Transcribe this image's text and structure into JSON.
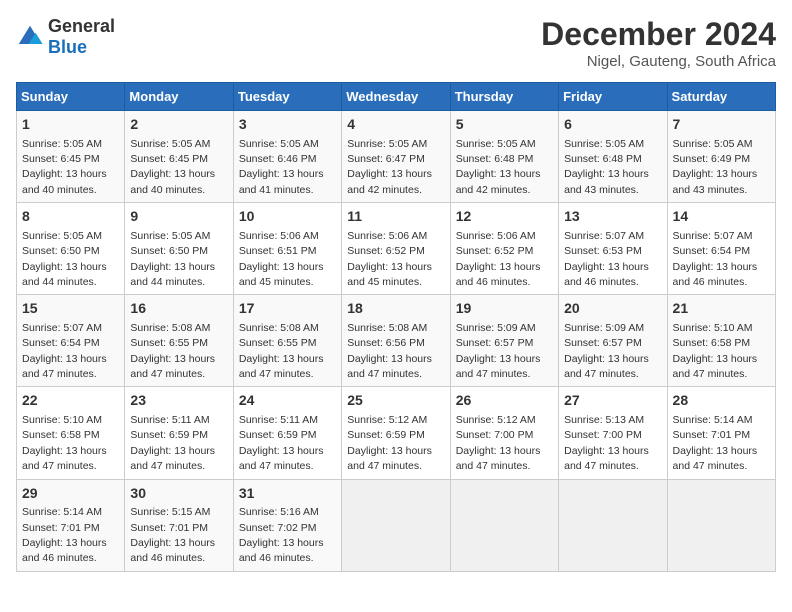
{
  "logo": {
    "general": "General",
    "blue": "Blue"
  },
  "title": "December 2024",
  "subtitle": "Nigel, Gauteng, South Africa",
  "days_of_week": [
    "Sunday",
    "Monday",
    "Tuesday",
    "Wednesday",
    "Thursday",
    "Friday",
    "Saturday"
  ],
  "weeks": [
    [
      {
        "day": "1",
        "info": "Sunrise: 5:05 AM\nSunset: 6:45 PM\nDaylight: 13 hours\nand 40 minutes."
      },
      {
        "day": "2",
        "info": "Sunrise: 5:05 AM\nSunset: 6:45 PM\nDaylight: 13 hours\nand 40 minutes."
      },
      {
        "day": "3",
        "info": "Sunrise: 5:05 AM\nSunset: 6:46 PM\nDaylight: 13 hours\nand 41 minutes."
      },
      {
        "day": "4",
        "info": "Sunrise: 5:05 AM\nSunset: 6:47 PM\nDaylight: 13 hours\nand 42 minutes."
      },
      {
        "day": "5",
        "info": "Sunrise: 5:05 AM\nSunset: 6:48 PM\nDaylight: 13 hours\nand 42 minutes."
      },
      {
        "day": "6",
        "info": "Sunrise: 5:05 AM\nSunset: 6:48 PM\nDaylight: 13 hours\nand 43 minutes."
      },
      {
        "day": "7",
        "info": "Sunrise: 5:05 AM\nSunset: 6:49 PM\nDaylight: 13 hours\nand 43 minutes."
      }
    ],
    [
      {
        "day": "8",
        "info": "Sunrise: 5:05 AM\nSunset: 6:50 PM\nDaylight: 13 hours\nand 44 minutes."
      },
      {
        "day": "9",
        "info": "Sunrise: 5:05 AM\nSunset: 6:50 PM\nDaylight: 13 hours\nand 44 minutes."
      },
      {
        "day": "10",
        "info": "Sunrise: 5:06 AM\nSunset: 6:51 PM\nDaylight: 13 hours\nand 45 minutes."
      },
      {
        "day": "11",
        "info": "Sunrise: 5:06 AM\nSunset: 6:52 PM\nDaylight: 13 hours\nand 45 minutes."
      },
      {
        "day": "12",
        "info": "Sunrise: 5:06 AM\nSunset: 6:52 PM\nDaylight: 13 hours\nand 46 minutes."
      },
      {
        "day": "13",
        "info": "Sunrise: 5:07 AM\nSunset: 6:53 PM\nDaylight: 13 hours\nand 46 minutes."
      },
      {
        "day": "14",
        "info": "Sunrise: 5:07 AM\nSunset: 6:54 PM\nDaylight: 13 hours\nand 46 minutes."
      }
    ],
    [
      {
        "day": "15",
        "info": "Sunrise: 5:07 AM\nSunset: 6:54 PM\nDaylight: 13 hours\nand 47 minutes."
      },
      {
        "day": "16",
        "info": "Sunrise: 5:08 AM\nSunset: 6:55 PM\nDaylight: 13 hours\nand 47 minutes."
      },
      {
        "day": "17",
        "info": "Sunrise: 5:08 AM\nSunset: 6:55 PM\nDaylight: 13 hours\nand 47 minutes."
      },
      {
        "day": "18",
        "info": "Sunrise: 5:08 AM\nSunset: 6:56 PM\nDaylight: 13 hours\nand 47 minutes."
      },
      {
        "day": "19",
        "info": "Sunrise: 5:09 AM\nSunset: 6:57 PM\nDaylight: 13 hours\nand 47 minutes."
      },
      {
        "day": "20",
        "info": "Sunrise: 5:09 AM\nSunset: 6:57 PM\nDaylight: 13 hours\nand 47 minutes."
      },
      {
        "day": "21",
        "info": "Sunrise: 5:10 AM\nSunset: 6:58 PM\nDaylight: 13 hours\nand 47 minutes."
      }
    ],
    [
      {
        "day": "22",
        "info": "Sunrise: 5:10 AM\nSunset: 6:58 PM\nDaylight: 13 hours\nand 47 minutes."
      },
      {
        "day": "23",
        "info": "Sunrise: 5:11 AM\nSunset: 6:59 PM\nDaylight: 13 hours\nand 47 minutes."
      },
      {
        "day": "24",
        "info": "Sunrise: 5:11 AM\nSunset: 6:59 PM\nDaylight: 13 hours\nand 47 minutes."
      },
      {
        "day": "25",
        "info": "Sunrise: 5:12 AM\nSunset: 6:59 PM\nDaylight: 13 hours\nand 47 minutes."
      },
      {
        "day": "26",
        "info": "Sunrise: 5:12 AM\nSunset: 7:00 PM\nDaylight: 13 hours\nand 47 minutes."
      },
      {
        "day": "27",
        "info": "Sunrise: 5:13 AM\nSunset: 7:00 PM\nDaylight: 13 hours\nand 47 minutes."
      },
      {
        "day": "28",
        "info": "Sunrise: 5:14 AM\nSunset: 7:01 PM\nDaylight: 13 hours\nand 47 minutes."
      }
    ],
    [
      {
        "day": "29",
        "info": "Sunrise: 5:14 AM\nSunset: 7:01 PM\nDaylight: 13 hours\nand 46 minutes."
      },
      {
        "day": "30",
        "info": "Sunrise: 5:15 AM\nSunset: 7:01 PM\nDaylight: 13 hours\nand 46 minutes."
      },
      {
        "day": "31",
        "info": "Sunrise: 5:16 AM\nSunset: 7:02 PM\nDaylight: 13 hours\nand 46 minutes."
      },
      {
        "day": "",
        "info": ""
      },
      {
        "day": "",
        "info": ""
      },
      {
        "day": "",
        "info": ""
      },
      {
        "day": "",
        "info": ""
      }
    ]
  ]
}
